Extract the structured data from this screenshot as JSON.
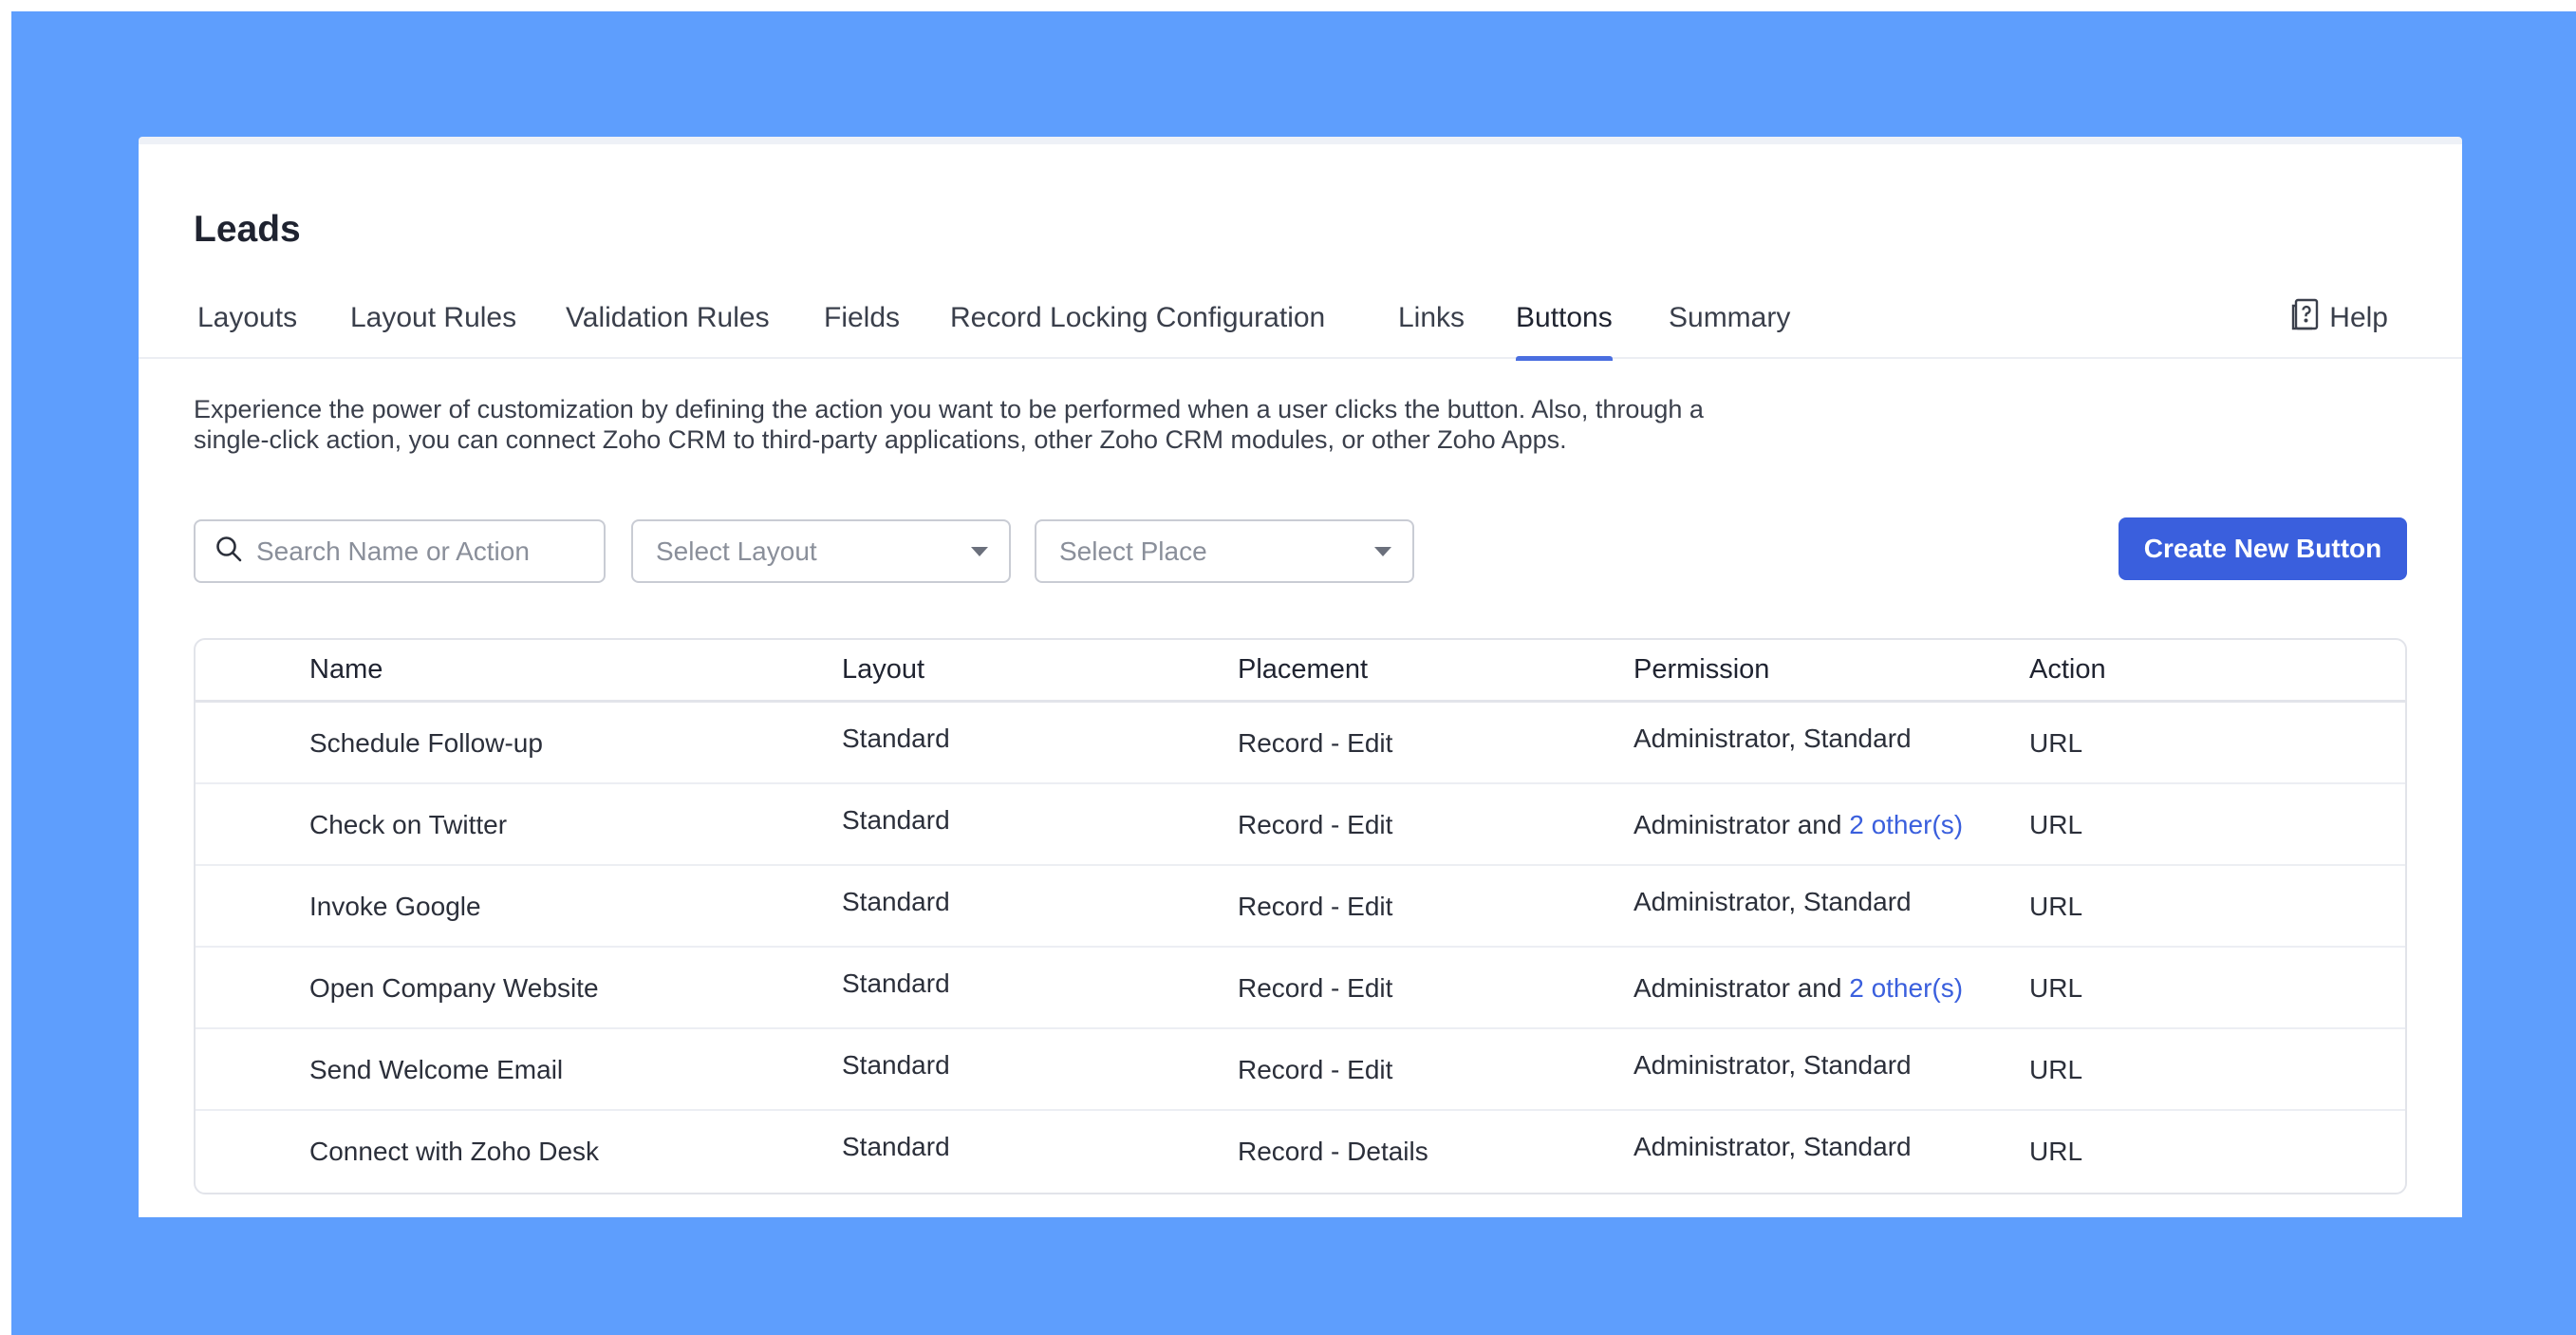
{
  "page": {
    "title": "Leads"
  },
  "tabs": [
    {
      "label": "Layouts",
      "active": false
    },
    {
      "label": "Layout Rules",
      "active": false
    },
    {
      "label": "Validation Rules",
      "active": false
    },
    {
      "label": "Fields",
      "active": false
    },
    {
      "label": "Record Locking Configuration",
      "active": false
    },
    {
      "label": "Links",
      "active": false
    },
    {
      "label": "Buttons",
      "active": true
    },
    {
      "label": "Summary",
      "active": false
    }
  ],
  "help": {
    "label": "Help",
    "icon": "help-book-icon"
  },
  "description": "Experience the power of customization by defining the action you want to be performed when a user clicks the button. Also, through a single-click action, you can connect Zoho CRM to third-party applications, other Zoho CRM modules, or other Zoho Apps.",
  "filters": {
    "search_placeholder": "Search Name or Action",
    "layout_placeholder": "Select Layout",
    "place_placeholder": "Select Place"
  },
  "create_button": "Create New Button",
  "table": {
    "headers": {
      "name": "Name",
      "layout": "Layout",
      "placement": "Placement",
      "permission": "Permission",
      "action": "Action"
    },
    "rows": [
      {
        "name": "Schedule Follow-up",
        "layout": "Standard",
        "placement": "Record - Edit",
        "permission": "Administrator, Standard",
        "permission_link": "",
        "action": "URL"
      },
      {
        "name": "Check on Twitter",
        "layout": "Standard",
        "placement": "Record - Edit",
        "permission": "Administrator and ",
        "permission_link": "2 other(s)",
        "action": "URL"
      },
      {
        "name": "Invoke Google",
        "layout": "Standard",
        "placement": "Record - Edit",
        "permission": "Administrator, Standard",
        "permission_link": "",
        "action": "URL"
      },
      {
        "name": "Open Company Website",
        "layout": "Standard",
        "placement": "Record - Edit",
        "permission": "Administrator and ",
        "permission_link": "2 other(s)",
        "action": "URL"
      },
      {
        "name": "Send Welcome Email",
        "layout": "Standard",
        "placement": "Record - Edit",
        "permission": "Administrator, Standard",
        "permission_link": "",
        "action": "URL"
      },
      {
        "name": "Connect with Zoho Desk",
        "layout": "Standard",
        "placement": "Record - Details",
        "permission": "Administrator, Standard",
        "permission_link": "",
        "action": "URL"
      }
    ]
  },
  "colors": {
    "background": "#5e9efd",
    "accent": "#3a5fdd",
    "link": "#3a5fdd"
  }
}
